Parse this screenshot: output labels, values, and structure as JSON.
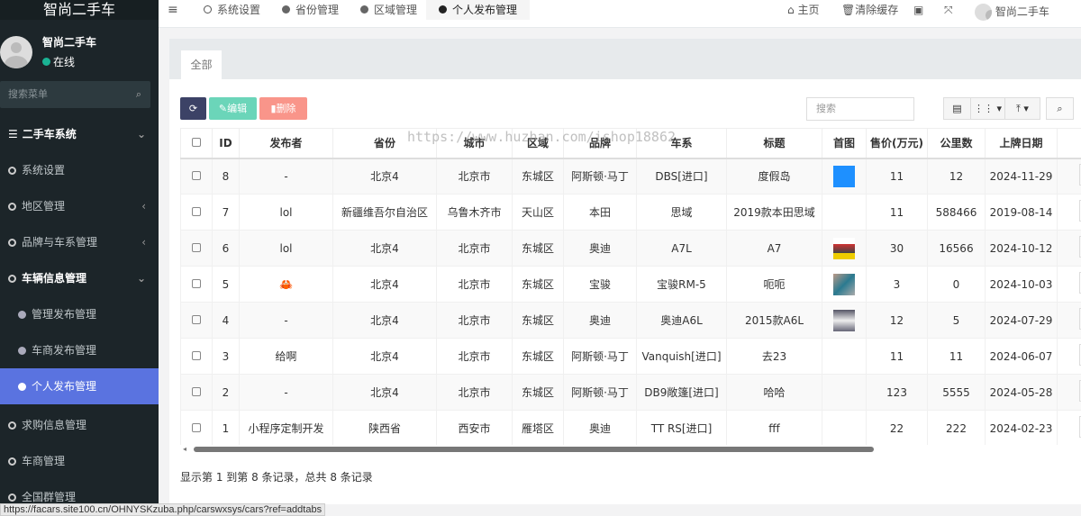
{
  "app": {
    "logo": "智尚二手车"
  },
  "user": {
    "name": "智尚二手车",
    "status": "在线",
    "status_color": "#1ab394"
  },
  "sidebar": {
    "search_placeholder": "搜索菜单",
    "items": [
      {
        "label": "二手车系统",
        "icon": "list-icon"
      },
      {
        "label": "系统设置"
      },
      {
        "label": "地区管理"
      },
      {
        "label": "品牌与车系管理"
      },
      {
        "label": "车辆信息管理"
      },
      {
        "label": "管理发布管理"
      },
      {
        "label": "车商发布管理"
      },
      {
        "label": "个人发布管理",
        "active": true
      },
      {
        "label": "求购信息管理"
      },
      {
        "label": "车商管理"
      },
      {
        "label": "全国群管理"
      }
    ]
  },
  "topbar": {
    "tabs": [
      "系统设置",
      "省份管理",
      "区域管理",
      "个人发布管理"
    ],
    "home": "主页",
    "clear_cache": "清除缓存",
    "username": "智尚二手车"
  },
  "panel": {
    "tab": "全部"
  },
  "toolbar": {
    "edit": "编辑",
    "delete": "删除",
    "search_placeholder": "搜索"
  },
  "table": {
    "headers": [
      "ID",
      "发布者",
      "省份",
      "城市",
      "区域",
      "品牌",
      "车系",
      "标题",
      "首图",
      "售价(万元)",
      "公里数",
      "上牌日期"
    ],
    "rows": [
      [
        "8",
        "-",
        "北京4",
        "北京市",
        "东城区",
        "阿斯顿·马丁",
        "DBS[进口]",
        "度假岛",
        "blue",
        "11",
        "12",
        "2024-11-29"
      ],
      [
        "7",
        "lol",
        "新疆维吾尔自治区",
        "乌鲁木齐市",
        "天山区",
        "本田",
        "思域",
        "2019款本田思域",
        "",
        "11",
        "588466",
        "2019-08-14"
      ],
      [
        "6",
        "lol",
        "北京4",
        "北京市",
        "东城区",
        "奥迪",
        "A7L",
        "A7",
        "screenshot",
        "30",
        "16566",
        "2024-10-12"
      ],
      [
        "5",
        "🦀",
        "北京4",
        "北京市",
        "东城区",
        "宝骏",
        "宝骏RM-5",
        "呃呃",
        "photo",
        "3",
        "0",
        "2024-10-03"
      ],
      [
        "4",
        "-",
        "北京4",
        "北京市",
        "东城区",
        "奥迪",
        "奥迪A6L",
        "2015款A6L",
        "car",
        "12",
        "5",
        "2024-07-29"
      ],
      [
        "3",
        "给啊",
        "北京4",
        "北京市",
        "东城区",
        "阿斯顿·马丁",
        "Vanquish[进口]",
        "去23",
        "",
        "11",
        "11",
        "2024-06-07"
      ],
      [
        "2",
        "-",
        "北京4",
        "北京市",
        "东城区",
        "阿斯顿·马丁",
        "DB9敞篷[进口]",
        "哈哈",
        "",
        "123",
        "5555",
        "2024-05-28"
      ],
      [
        "1",
        "小程序定制开发",
        "陕西省",
        "西安市",
        "雁塔区",
        "奥迪",
        "TT RS[进口]",
        "fff",
        "",
        "22",
        "222",
        "2024-02-23"
      ]
    ]
  },
  "footer": "显示第 1 到第 8 条记录，总共 8 条记录",
  "watermark": "https://www.huzhan.com/ishop18862",
  "statusbar": "https://facars.site100.cn/OHNYSKzuba.php/carswxsys/cars?ref=addtabs"
}
